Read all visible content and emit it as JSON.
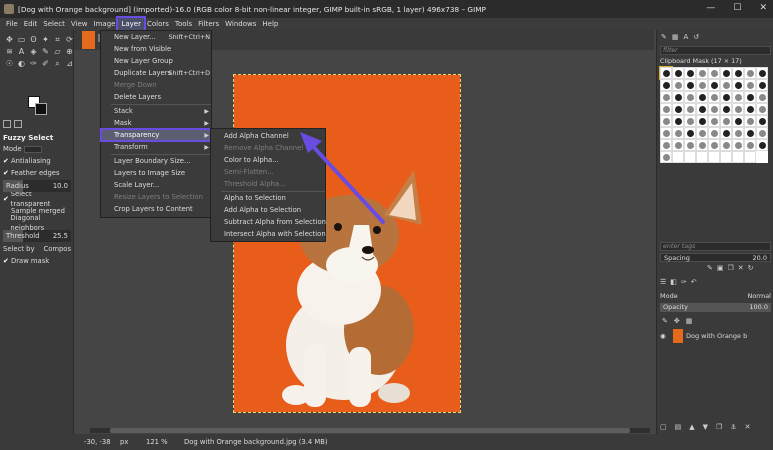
{
  "window": {
    "title": "[Dog with Orange background] (imported)-16.0 (RGB color 8-bit non-linear integer, GIMP built-in sRGB, 1 layer) 496x738 – GIMP",
    "controls": [
      "—",
      "☐",
      "✕"
    ]
  },
  "menubar": [
    "File",
    "Edit",
    "Select",
    "View",
    "Image",
    "Layer",
    "Colors",
    "Tools",
    "Filters",
    "Windows",
    "Help"
  ],
  "tool_options": {
    "title": "Fuzzy Select",
    "mode_label": "Mode",
    "antialiasing": "Antialiasing",
    "feather": "Feather edges",
    "radius_label": "Radius",
    "radius_value": "10.0",
    "select_transparent": "Select transparent",
    "sample_merged": "Sample merged",
    "diagonal": "Diagonal neighbors",
    "threshold_label": "Threshold",
    "threshold_value": "25.5",
    "select_by_label": "Select by",
    "select_by_value": "Compos",
    "draw_mask": "Draw mask"
  },
  "layer_menu": {
    "items": [
      {
        "label": "New Layer...",
        "shortcut": "Shift+Ctrl+N"
      },
      {
        "label": "New from Visible"
      },
      {
        "label": "New Layer Group"
      },
      {
        "label": "Duplicate Layers",
        "shortcut": "Shift+Ctrl+D"
      },
      {
        "label": "Merge Down"
      },
      {
        "label": "Delete Layers"
      },
      {
        "label": "Stack"
      },
      {
        "label": "Mask"
      },
      {
        "label": "Transparency"
      },
      {
        "label": "Transform"
      },
      {
        "label": "Layer Boundary Size..."
      },
      {
        "label": "Layers to Image Size"
      },
      {
        "label": "Scale Layer..."
      },
      {
        "label": "Resize Layers to Selection"
      },
      {
        "label": "Crop Layers to Content"
      }
    ]
  },
  "transparency_menu": {
    "items": [
      {
        "label": "Add Alpha Channel"
      },
      {
        "label": "Remove Alpha Channel"
      },
      {
        "label": "Color to Alpha..."
      },
      {
        "label": "Semi-Flatten..."
      },
      {
        "label": "Threshold Alpha..."
      },
      {
        "label": "Alpha to Selection"
      },
      {
        "label": "Add Alpha to Selection"
      },
      {
        "label": "Subtract Alpha from Selection"
      },
      {
        "label": "Intersect Alpha with Selection"
      }
    ]
  },
  "status": {
    "coords": "-30, -38",
    "unit": "px",
    "zoom": "121 %",
    "message": "Dog with Orange background.jpg (3.4 MB)"
  },
  "brushes": {
    "filter_placeholder": "filter",
    "title": "Clipboard Mask (17 × 17)",
    "tags_placeholder": "enter tags",
    "spacing_label": "Spacing",
    "spacing_value": "20.0"
  },
  "layers": {
    "mode_label": "Mode",
    "mode_value": "Normal",
    "opacity_label": "Opacity",
    "opacity_value": "100.0",
    "layer_name": "Dog with Orange b"
  },
  "colors": {
    "accent": "#6a4ce0",
    "canvas_orange": "#e95d1a"
  }
}
